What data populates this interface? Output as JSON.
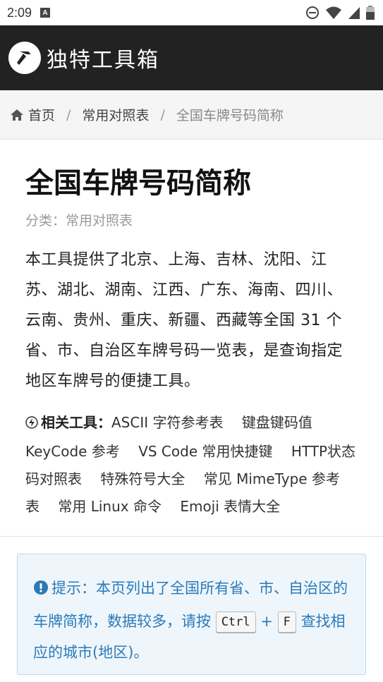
{
  "status_bar": {
    "time": "2:09",
    "icons": [
      "a-notification-icon",
      "do-not-disturb-icon",
      "wifi-icon",
      "signal-icon",
      "battery-icon"
    ]
  },
  "header": {
    "title": "独特工具箱",
    "logo_icon": "hammer-icon"
  },
  "breadcrumb": {
    "home": "首页",
    "category": "常用对照表",
    "current": "全国车牌号码简称",
    "separator": "/"
  },
  "main": {
    "title": "全国车牌号码简称",
    "category_label": "分类：",
    "category_value": "常用对照表",
    "description": "本工具提供了北京、上海、吉林、沈阳、江苏、湖北、湖南、江西、广东、海南、四川、云南、贵州、重庆、新疆、西藏等全国 31 个省、市、自治区车牌号码一览表，是查询指定地区车牌号的便捷工具。",
    "related_label": "相关工具：",
    "related_tools": [
      "ASCII 字符参考表",
      "键盘键码值 KeyCode 参考",
      "VS Code 常用快捷键",
      "HTTP状态码对照表",
      "特殊符号大全",
      "常见 MimeType 参考表",
      "常用 Linux 命令",
      "Emoji 表情大全"
    ]
  },
  "tip": {
    "text_before": "提示：本页列出了全国所有省、市、自治区的车牌简称，数据较多，请按",
    "key1": "Ctrl",
    "plus": "+",
    "key2": "F",
    "text_after": "查找相应的城市(地区)。"
  },
  "colors": {
    "header_bg": "#222222",
    "tip_text": "#2a7ab8",
    "tip_bg": "#eef6fc"
  }
}
